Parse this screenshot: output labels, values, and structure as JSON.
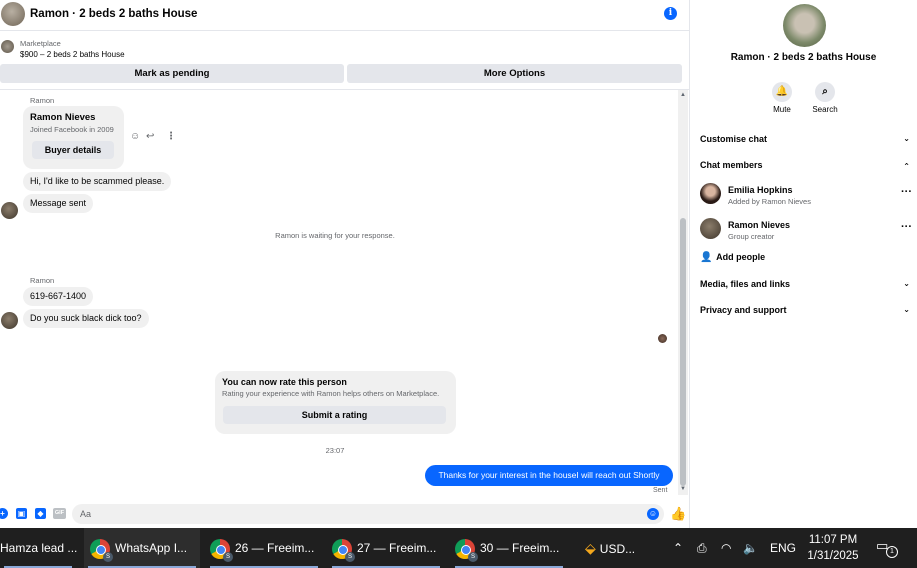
{
  "header": {
    "title": "Ramon · 2 beds 2 baths House",
    "info_icon": "i"
  },
  "listing": {
    "label": "Marketplace",
    "price_line": "$900 – 2 beds 2 baths House"
  },
  "actions": {
    "mark_pending": "Mark as pending",
    "more_options": "More Options"
  },
  "messages": {
    "sender_1": "Ramon",
    "card_name": "Ramon Nieves",
    "card_joined": "Joined Facebook in 2009",
    "card_button": "Buyer details",
    "msg_1": "Hi, I'd like to be scammed please.",
    "msg_2": "Message sent",
    "system": "Ramon is waiting for your response.",
    "sender_2": "Ramon",
    "msg_3": "619-667-1400",
    "msg_4": "Do you suck black dick too?",
    "rate_title": "You can now rate this person",
    "rate_sub": "Rating your experience with Ramon helps others on Marketplace.",
    "rate_button": "Submit a rating",
    "timestamp": "23:07",
    "outgoing": "Thanks for your interest in the houseI will reach out Shortly",
    "status": "Sent"
  },
  "composer": {
    "placeholder": "Aa",
    "gif_label": "GIF"
  },
  "panel": {
    "name": "Ramon · 2 beds 2 baths House",
    "mute": "Mute",
    "search": "Search",
    "customise": "Customise chat",
    "members_header": "Chat members",
    "members": [
      {
        "name": "Emilia Hopkins",
        "sub": "Added by Ramon Nieves"
      },
      {
        "name": "Ramon Nieves",
        "sub": "Group creator"
      }
    ],
    "add_people": "Add people",
    "media": "Media, files and links",
    "privacy": "Privacy and support"
  },
  "taskbar": {
    "items": [
      "Hamza lead ...",
      "WhatsApp I...",
      "26 — Freeim...",
      "27 — Freeim...",
      "30 — Freeim...",
      "USD..."
    ],
    "badge": "S",
    "lang": "ENG",
    "time": "11:07 PM",
    "date": "1/31/2025",
    "notifications": "1"
  },
  "colors": {
    "accent": "#0866ff",
    "bubble": "#f0f0f0",
    "taskbar": "#1f1f1f"
  }
}
